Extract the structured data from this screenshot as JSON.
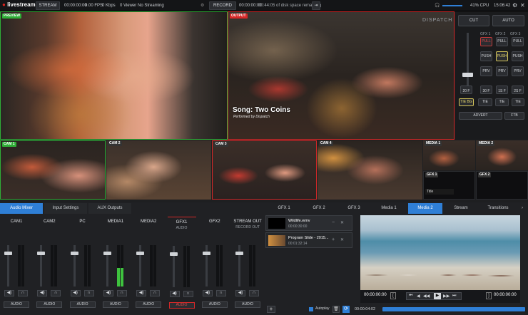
{
  "app": {
    "logo": "livestream"
  },
  "topbar": {
    "stream_btn": "STREAM",
    "stream_time": "00:00:00:00",
    "bitrate": "0.00 FPS",
    "kbps": "0 Kbps",
    "viewers": "0 Viewer",
    "streaming_status": "No Streaming",
    "record_btn": "RECORD",
    "record_time": "00:00:00:00",
    "disk_space": "00:44:05 of disk space remaining",
    "cpu": "41% CPU",
    "clock": "15:06:42"
  },
  "preview": {
    "label": "PREVIEW"
  },
  "output": {
    "label": "OUTPUT",
    "lower_third_title": "Song: Two Coins",
    "lower_third_sub": "Performed by Dispatch",
    "watermark": "DISPATCH"
  },
  "cams": [
    {
      "label": "CAM 1"
    },
    {
      "label": "CAM 2"
    },
    {
      "label": "CAM 3"
    },
    {
      "label": "CAM 4"
    },
    {
      "label": "MEDIA 1"
    },
    {
      "label": "MEDIA 2"
    }
  ],
  "gfx_thumbs": [
    {
      "label": "GFX 1"
    },
    {
      "label": "GFX 2"
    }
  ],
  "gfx1_mini": "Title",
  "control": {
    "cut": "CUT",
    "auto": "AUTO",
    "gfx_headers": [
      "GFX 1",
      "GFX 2",
      "GFX 3"
    ],
    "pull": "PULL",
    "push": "PUSH",
    "prv": "PRV",
    "transitions": [
      "20 F",
      "30 F",
      "1S F",
      "2S F"
    ],
    "tie_row": [
      "TIE BG",
      "TIE",
      "TIE",
      "TIE"
    ],
    "advert": "ADVERT",
    "ftb": "FTB"
  },
  "bottom_tabs_left": [
    "Audio Mixer",
    "Input Settings",
    "AUX Outputs"
  ],
  "bottom_tabs_right": [
    "GFX 1",
    "GFX 2",
    "GFX 3",
    "Media 1",
    "Media 2",
    "Stream",
    "Transitions"
  ],
  "mixer": {
    "channels": [
      "CAM1",
      "CAM2",
      "PC",
      "MEDIA1",
      "MEDIA2",
      "GFX1",
      "GFX2",
      "STREAM OUT"
    ],
    "sub_labels": [
      "",
      "",
      "",
      "",
      "",
      "AUDIO",
      "",
      "RECORD OUT"
    ],
    "audio_label": "AUDIO",
    "meter_level": [
      0.0,
      0.0,
      0.0,
      0.45,
      0.0,
      0.0,
      0.0,
      0.0
    ]
  },
  "playlist": {
    "items": [
      {
        "name": "Wildlife.wmv",
        "duration": "00:00:30:00"
      },
      {
        "name": "Program Slide - 2015...",
        "duration": "00:01:32:14"
      }
    ],
    "autoplay": "Autoplay"
  },
  "player": {
    "time_left": "00:00:00:00",
    "time_right": "00:00:00:00",
    "bottom_time": "00:00:04:02"
  },
  "colors": {
    "accent": "#2f7fd6",
    "preview": "#2fae37",
    "output": "#d62828",
    "pull": "#c23a3a",
    "push": "#d6c65a"
  }
}
